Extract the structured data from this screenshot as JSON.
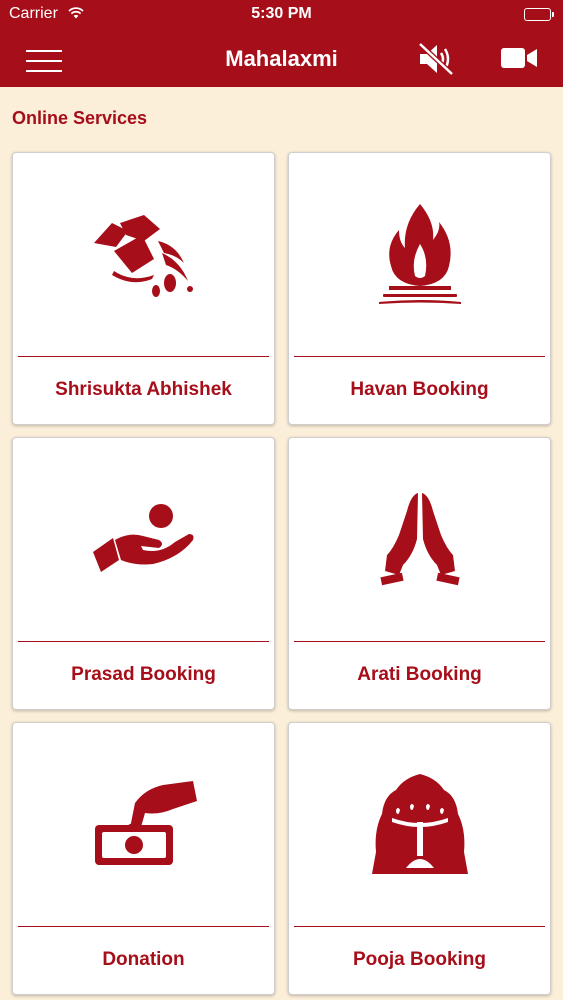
{
  "status_bar": {
    "carrier": "Carrier",
    "time": "5:30 PM"
  },
  "nav": {
    "title": "Mahalaxmi",
    "icons": [
      "menu-icon",
      "mute-icon",
      "video-camera-icon"
    ]
  },
  "section": {
    "title": "Online Services"
  },
  "services": [
    {
      "label": "Shrisukta Abhishek",
      "icon": "abhishek-icon"
    },
    {
      "label": "Havan Booking",
      "icon": "fire-icon"
    },
    {
      "label": "Prasad Booking",
      "icon": "hand-offering-icon"
    },
    {
      "label": "Arati Booking",
      "icon": "praying-hands-icon"
    },
    {
      "label": "Donation",
      "icon": "donation-hand-icon"
    },
    {
      "label": "Pooja Booking",
      "icon": "diya-lamp-icon"
    }
  ],
  "colors": {
    "brand": "#a60e19",
    "background": "#fcefd9",
    "card": "#ffffff"
  }
}
